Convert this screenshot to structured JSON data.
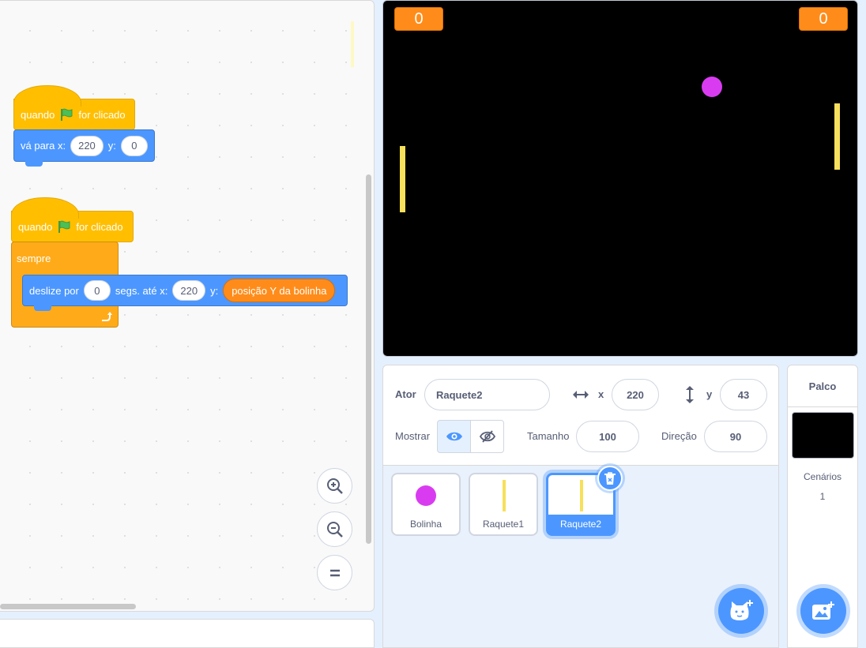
{
  "code": {
    "script1": {
      "hat_when": "quando",
      "hat_clicked": "for clicado",
      "goto_label": "vá para x:",
      "goto_x": "220",
      "y_label": "y:",
      "goto_y": "0"
    },
    "script2": {
      "hat_when": "quando",
      "hat_clicked": "for clicado",
      "forever_label": "sempre",
      "glide_label": "deslize por",
      "glide_secs": "0",
      "glide_to_label": "segs. até x:",
      "glide_x": "220",
      "y_label": "y:",
      "reporter": "posição Y da bolinha"
    },
    "zoom_in_icon": "zoom-in-icon",
    "zoom_out_icon": "zoom-out-icon",
    "zoom_reset_icon": "zoom-reset-icon"
  },
  "stage": {
    "score_left": "0",
    "score_right": "0"
  },
  "sprite_info": {
    "sprite_label": "Ator",
    "sprite_name": "Raquete2",
    "x_label": "x",
    "x_value": "220",
    "y_label": "y",
    "y_value": "43",
    "show_label": "Mostrar",
    "size_label": "Tamanho",
    "size_value": "100",
    "direction_label": "Direção",
    "direction_value": "90"
  },
  "sprites": [
    {
      "name": "Bolinha"
    },
    {
      "name": "Raquete1"
    },
    {
      "name": "Raquete2"
    }
  ],
  "stage_panel": {
    "title": "Palco",
    "backdrops_label": "Cenários",
    "backdrops_count": "1"
  },
  "colors": {
    "events": "#ffbf00",
    "motion": "#4c97ff",
    "control": "#ffab19",
    "sensing_reporter": "#ff8c1a",
    "ball": "#d93cf0",
    "paddle": "#f7e05b"
  }
}
